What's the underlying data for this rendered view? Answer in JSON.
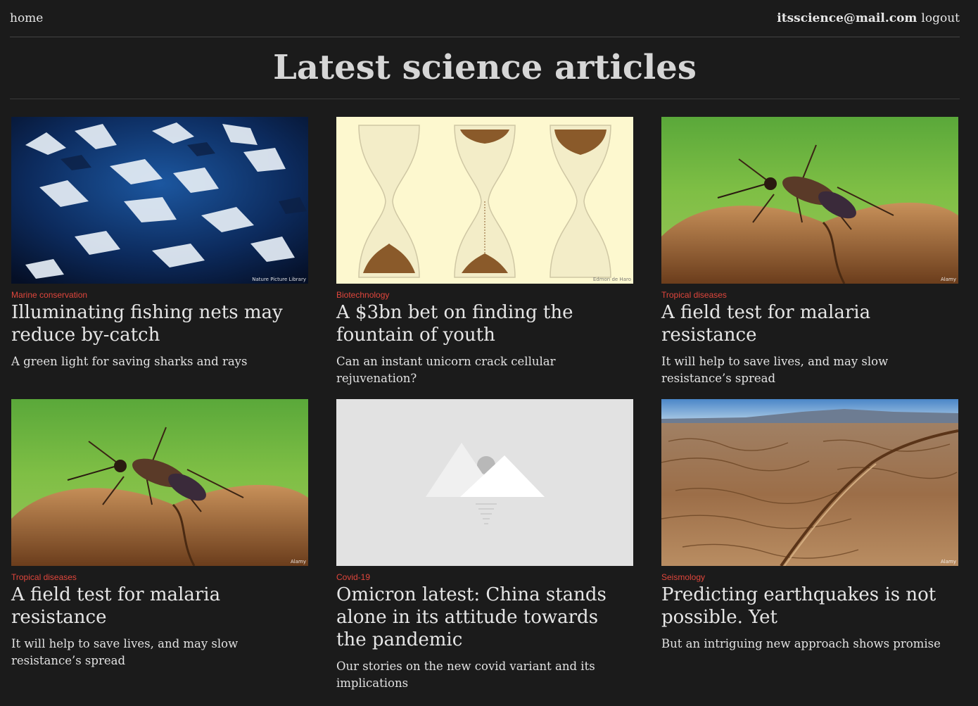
{
  "nav": {
    "home": "home",
    "email": "itsscience@mail.com",
    "logout": "logout"
  },
  "page_title": "Latest science articles",
  "articles": [
    {
      "category": "Marine conservation",
      "headline": "Illuminating fishing nets may reduce by-catch",
      "summary": "A green light for saving sharks and rays",
      "image_credit": "Nature Picture Library"
    },
    {
      "category": "Biotechnology",
      "headline": "A $3bn bet on finding the fountain of youth",
      "summary": "Can an instant unicorn crack cellular rejuvenation?",
      "image_credit": "Edmon de Haro"
    },
    {
      "category": "Tropical diseases",
      "headline": "A field test for malaria resistance",
      "summary": "It will help to save lives, and may slow resistance’s spread",
      "image_credit": "Alamy"
    },
    {
      "category": "Tropical diseases",
      "headline": "A field test for malaria resistance",
      "summary": "It will help to save lives, and may slow resistance’s spread",
      "image_credit": "Alamy"
    },
    {
      "category": "Covid-19",
      "headline": "Omicron latest: China stands alone in its attitude towards the pandemic",
      "summary": "Our stories on the new covid variant and its implications",
      "image_credit": ""
    },
    {
      "category": "Seismology",
      "headline": "Predicting earthquakes is not possible. Yet",
      "summary": "But an intriguing new approach shows promise",
      "image_credit": "Alamy"
    }
  ],
  "colors": {
    "background": "#1b1b1b",
    "category": "#e0463c",
    "text": "#e6e6e6"
  }
}
